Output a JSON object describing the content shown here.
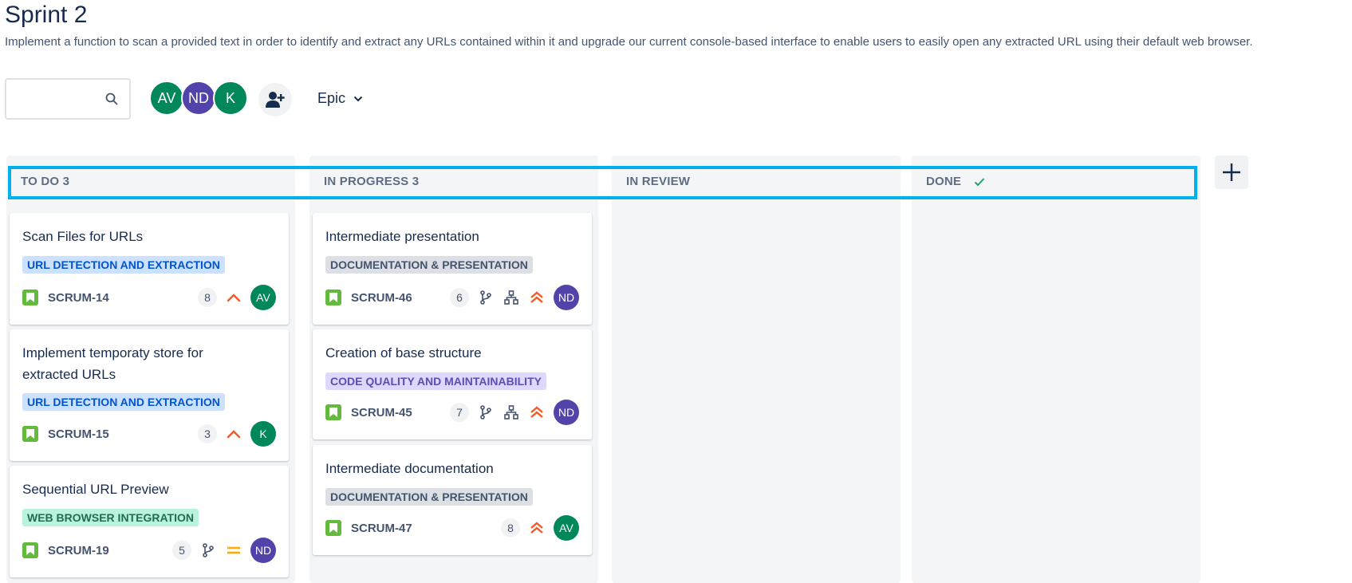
{
  "header": {
    "title": "Sprint 2",
    "description": "Implement a function to scan a provided text in order to identify and extract any URLs contained within it and upgrade our current console-based interface to enable users to easily open any extracted URL using their default web browser."
  },
  "toolbar": {
    "search_placeholder": "",
    "avatars": [
      {
        "initials": "AV",
        "color": "#00875a"
      },
      {
        "initials": "ND",
        "color": "#5243aa"
      },
      {
        "initials": "K",
        "color": "#00875a"
      }
    ],
    "epic_label": "Epic"
  },
  "columns": [
    {
      "title": "TO DO 3"
    },
    {
      "title": "IN PROGRESS 3"
    },
    {
      "title": "IN REVIEW"
    },
    {
      "title": "DONE"
    }
  ],
  "cards": {
    "todo": [
      {
        "title": "Scan Files for URLs",
        "epic": "URL DETECTION AND EXTRACTION",
        "key": "SCRUM-14",
        "estimate": "8",
        "assignee": "AV"
      },
      {
        "title": "Implement temporaty store for extracted URLs",
        "epic": "URL DETECTION AND EXTRACTION",
        "key": "SCRUM-15",
        "estimate": "3",
        "assignee": "K"
      },
      {
        "title": "Sequential URL Preview",
        "epic": "WEB BROWSER INTEGRATION",
        "key": "SCRUM-19",
        "estimate": "5",
        "assignee": "ND"
      }
    ],
    "inprogress": [
      {
        "title": "Intermediate presentation",
        "epic": "DOCUMENTATION & PRESENTATION",
        "key": "SCRUM-46",
        "estimate": "6",
        "assignee": "ND"
      },
      {
        "title": "Creation of base structure",
        "epic": "CODE QUALITY AND MAINTAINABILITY",
        "key": "SCRUM-45",
        "estimate": "7",
        "assignee": "ND"
      },
      {
        "title": "Intermediate documentation",
        "epic": "DOCUMENTATION & PRESENTATION",
        "key": "SCRUM-47",
        "estimate": "8",
        "assignee": "AV"
      }
    ]
  },
  "colors": {
    "epic_blue_bg": "#cce0ff",
    "epic_blue_fg": "#0055cc",
    "epic_gray_bg": "#dcdfe4",
    "epic_gray_fg": "#44546f",
    "epic_purple_bg": "#dfd8fd",
    "epic_purple_fg": "#5e4db2",
    "epic_green_bg": "#baf3db",
    "epic_green_fg": "#216e4e",
    "highlight": "#00b0ec",
    "priority_high": "#f15b2a",
    "priority_medium": "#ffab00",
    "done_check": "#22a06b"
  },
  "icons": {
    "search": "search-icon",
    "add_people": "add-person-icon",
    "epic_chevron": "chevron-down-icon",
    "add_column": "plus-icon",
    "story": "story-icon",
    "branch": "branch-icon",
    "hierarchy": "child-issues-icon",
    "priority_high": "priority-high-icon",
    "priority_highest": "priority-highest-icon",
    "priority_medium": "priority-medium-icon",
    "done": "check-icon"
  }
}
